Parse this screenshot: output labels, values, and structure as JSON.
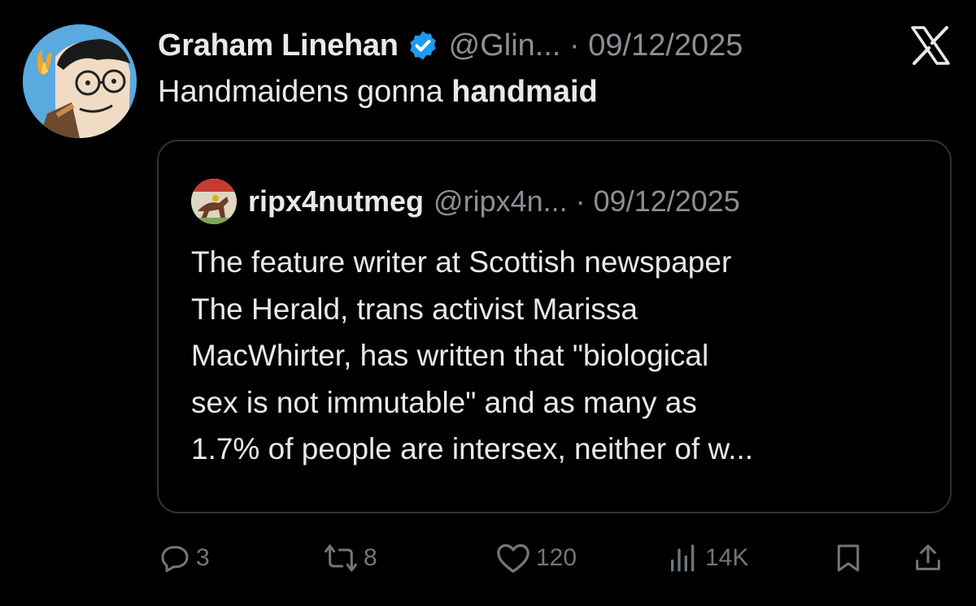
{
  "tweet": {
    "author_name": "Graham Linehan",
    "handle_date": "@Glin... · 09/12/2025",
    "text_prefix": "Handmaidens gonna ",
    "text_bold": "handmaid"
  },
  "quoted_tweet": {
    "author_name": "ripx4nutmeg",
    "handle_date": "@ripx4n... · 09/12/2025",
    "lines": [
      "The feature writer at Scottish newspaper",
      "The Herald, trans activist Marissa",
      "MacWhirter, has written that \"biological",
      "sex is not immutable\" and as many as",
      "1.7% of people are intersex, neither of w..."
    ]
  },
  "actions": {
    "replies": "3",
    "reposts": "8",
    "likes": "120",
    "views": "14K"
  },
  "colors": {
    "background": "#000000",
    "text": "#e7e9ea",
    "secondary_text": "#71767b",
    "verified": "#1d9bf0",
    "border": "#2f3336"
  },
  "icons": [
    "verified-badge-icon",
    "x-logo-icon",
    "reply-icon",
    "repost-icon",
    "like-icon",
    "views-icon",
    "bookmark-icon",
    "share-icon"
  ]
}
